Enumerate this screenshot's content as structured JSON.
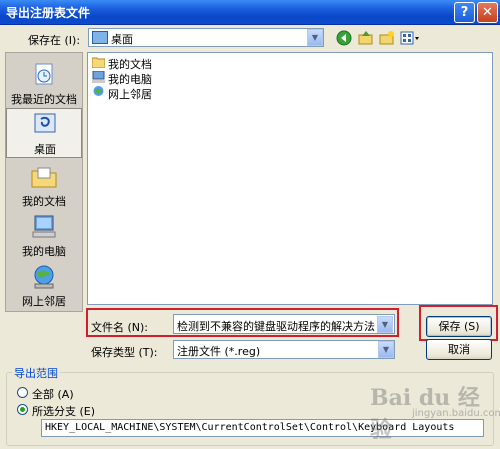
{
  "window": {
    "title": "导出注册表文件",
    "help": "?",
    "close": "✕"
  },
  "save_in": {
    "label": "保存在 (I):",
    "value": "桌面"
  },
  "places": [
    {
      "label": "我最近的文档",
      "icon": "recent-documents-icon"
    },
    {
      "label": "桌面",
      "icon": "desktop-icon"
    },
    {
      "label": "我的文档",
      "icon": "my-documents-icon"
    },
    {
      "label": "我的电脑",
      "icon": "my-computer-icon"
    },
    {
      "label": "网上邻居",
      "icon": "network-places-icon"
    }
  ],
  "files": [
    {
      "name": "我的文档",
      "icon": "my-documents-icon"
    },
    {
      "name": "我的电脑",
      "icon": "my-computer-icon"
    },
    {
      "name": "网上邻居",
      "icon": "network-places-icon"
    }
  ],
  "filename": {
    "label": "文件名 (N):",
    "value": "检测到不兼容的键盘驱动程序的解决方法"
  },
  "save_type": {
    "label": "保存类型 (T):",
    "value": "注册文件 (*.reg)"
  },
  "buttons": {
    "save": "保存 (S)",
    "cancel": "取消"
  },
  "export_range": {
    "label": "导出范围",
    "all": "全部 (A)",
    "selected": "所选分支 (E)",
    "branch": "HKEY_LOCAL_MACHINE\\SYSTEM\\CurrentControlSet\\Control\\Keyboard Layouts"
  },
  "watermark": {
    "brand": "Bai du 经验",
    "sub": "jingyan.baidu.com"
  },
  "colors": {
    "highlight": "#d1202d",
    "titlebar": "#0a47c7"
  }
}
